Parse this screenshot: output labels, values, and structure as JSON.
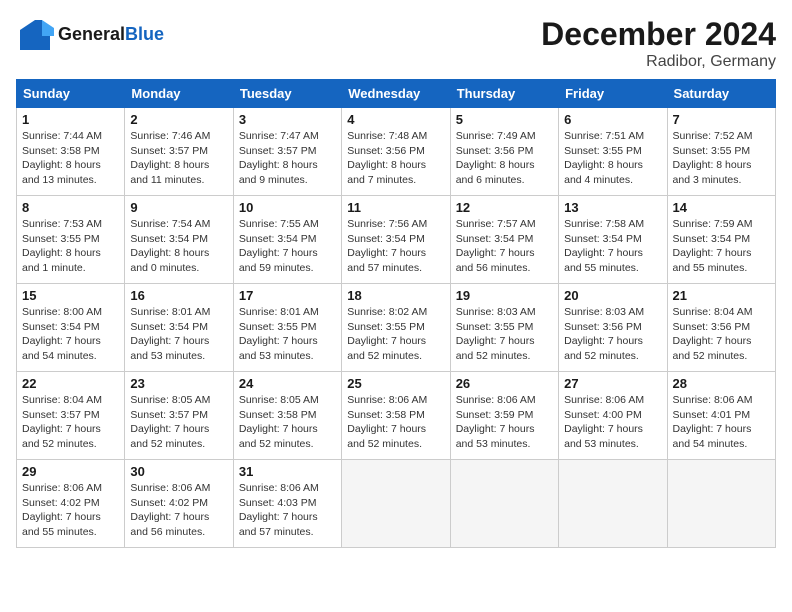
{
  "header": {
    "logo_line1": "General",
    "logo_line2": "Blue",
    "title": "December 2024",
    "subtitle": "Radibor, Germany"
  },
  "calendar": {
    "days_of_week": [
      "Sunday",
      "Monday",
      "Tuesday",
      "Wednesday",
      "Thursday",
      "Friday",
      "Saturday"
    ],
    "weeks": [
      [
        {
          "day": "",
          "info": ""
        },
        {
          "day": "2",
          "info": "Sunrise: 7:46 AM\nSunset: 3:57 PM\nDaylight: 8 hours\nand 11 minutes."
        },
        {
          "day": "3",
          "info": "Sunrise: 7:47 AM\nSunset: 3:57 PM\nDaylight: 8 hours\nand 9 minutes."
        },
        {
          "day": "4",
          "info": "Sunrise: 7:48 AM\nSunset: 3:56 PM\nDaylight: 8 hours\nand 7 minutes."
        },
        {
          "day": "5",
          "info": "Sunrise: 7:49 AM\nSunset: 3:56 PM\nDaylight: 8 hours\nand 6 minutes."
        },
        {
          "day": "6",
          "info": "Sunrise: 7:51 AM\nSunset: 3:55 PM\nDaylight: 8 hours\nand 4 minutes."
        },
        {
          "day": "7",
          "info": "Sunrise: 7:52 AM\nSunset: 3:55 PM\nDaylight: 8 hours\nand 3 minutes."
        }
      ],
      [
        {
          "day": "8",
          "info": "Sunrise: 7:53 AM\nSunset: 3:55 PM\nDaylight: 8 hours\nand 1 minute."
        },
        {
          "day": "9",
          "info": "Sunrise: 7:54 AM\nSunset: 3:54 PM\nDaylight: 8 hours\nand 0 minutes."
        },
        {
          "day": "10",
          "info": "Sunrise: 7:55 AM\nSunset: 3:54 PM\nDaylight: 7 hours\nand 59 minutes."
        },
        {
          "day": "11",
          "info": "Sunrise: 7:56 AM\nSunset: 3:54 PM\nDaylight: 7 hours\nand 57 minutes."
        },
        {
          "day": "12",
          "info": "Sunrise: 7:57 AM\nSunset: 3:54 PM\nDaylight: 7 hours\nand 56 minutes."
        },
        {
          "day": "13",
          "info": "Sunrise: 7:58 AM\nSunset: 3:54 PM\nDaylight: 7 hours\nand 55 minutes."
        },
        {
          "day": "14",
          "info": "Sunrise: 7:59 AM\nSunset: 3:54 PM\nDaylight: 7 hours\nand 55 minutes."
        }
      ],
      [
        {
          "day": "15",
          "info": "Sunrise: 8:00 AM\nSunset: 3:54 PM\nDaylight: 7 hours\nand 54 minutes."
        },
        {
          "day": "16",
          "info": "Sunrise: 8:01 AM\nSunset: 3:54 PM\nDaylight: 7 hours\nand 53 minutes."
        },
        {
          "day": "17",
          "info": "Sunrise: 8:01 AM\nSunset: 3:55 PM\nDaylight: 7 hours\nand 53 minutes."
        },
        {
          "day": "18",
          "info": "Sunrise: 8:02 AM\nSunset: 3:55 PM\nDaylight: 7 hours\nand 52 minutes."
        },
        {
          "day": "19",
          "info": "Sunrise: 8:03 AM\nSunset: 3:55 PM\nDaylight: 7 hours\nand 52 minutes."
        },
        {
          "day": "20",
          "info": "Sunrise: 8:03 AM\nSunset: 3:56 PM\nDaylight: 7 hours\nand 52 minutes."
        },
        {
          "day": "21",
          "info": "Sunrise: 8:04 AM\nSunset: 3:56 PM\nDaylight: 7 hours\nand 52 minutes."
        }
      ],
      [
        {
          "day": "22",
          "info": "Sunrise: 8:04 AM\nSunset: 3:57 PM\nDaylight: 7 hours\nand 52 minutes."
        },
        {
          "day": "23",
          "info": "Sunrise: 8:05 AM\nSunset: 3:57 PM\nDaylight: 7 hours\nand 52 minutes."
        },
        {
          "day": "24",
          "info": "Sunrise: 8:05 AM\nSunset: 3:58 PM\nDaylight: 7 hours\nand 52 minutes."
        },
        {
          "day": "25",
          "info": "Sunrise: 8:06 AM\nSunset: 3:58 PM\nDaylight: 7 hours\nand 52 minutes."
        },
        {
          "day": "26",
          "info": "Sunrise: 8:06 AM\nSunset: 3:59 PM\nDaylight: 7 hours\nand 53 minutes."
        },
        {
          "day": "27",
          "info": "Sunrise: 8:06 AM\nSunset: 4:00 PM\nDaylight: 7 hours\nand 53 minutes."
        },
        {
          "day": "28",
          "info": "Sunrise: 8:06 AM\nSunset: 4:01 PM\nDaylight: 7 hours\nand 54 minutes."
        }
      ],
      [
        {
          "day": "29",
          "info": "Sunrise: 8:06 AM\nSunset: 4:02 PM\nDaylight: 7 hours\nand 55 minutes."
        },
        {
          "day": "30",
          "info": "Sunrise: 8:06 AM\nSunset: 4:02 PM\nDaylight: 7 hours\nand 56 minutes."
        },
        {
          "day": "31",
          "info": "Sunrise: 8:06 AM\nSunset: 4:03 PM\nDaylight: 7 hours\nand 57 minutes."
        },
        {
          "day": "",
          "info": ""
        },
        {
          "day": "",
          "info": ""
        },
        {
          "day": "",
          "info": ""
        },
        {
          "day": "",
          "info": ""
        }
      ]
    ],
    "week0_day1": {
      "day": "1",
      "info": "Sunrise: 7:44 AM\nSunset: 3:58 PM\nDaylight: 8 hours\nand 13 minutes."
    }
  }
}
